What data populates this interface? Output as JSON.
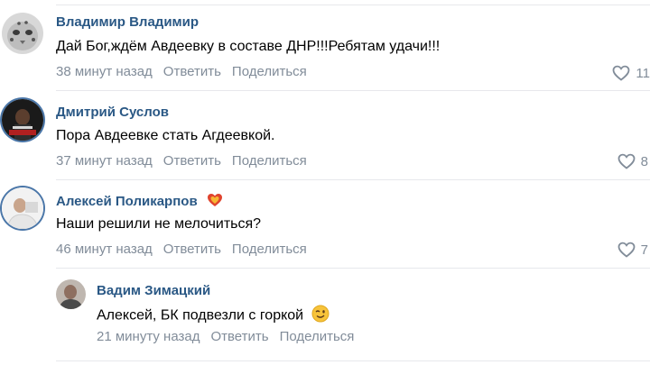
{
  "comments": [
    {
      "author": "Владимир Владимир",
      "text": "Дай Бог,ждём Авдеевку в составе ДНР!!!Ребятам удачи!!!",
      "time": "38 минут назад",
      "reply_label": "Ответить",
      "share_label": "Поделиться",
      "likes": "11",
      "avatar": "snow-leopard-avatar"
    },
    {
      "author": "Дмитрий Суслов",
      "text": "Пора Авдеевке стать Агдеевкой.",
      "time": "37 минут назад",
      "reply_label": "Ответить",
      "share_label": "Поделиться",
      "likes": "8",
      "avatar": "dark-photo-avatar"
    },
    {
      "author": "Алексей Поликарпов",
      "text": "Наши решили не мелочиться?",
      "time": "46 минут назад",
      "reply_label": "Ответить",
      "share_label": "Поделиться",
      "likes": "7",
      "avatar": "person-avatar",
      "badge_icon": "heart-badge-icon"
    }
  ],
  "reply": {
    "author": "Вадим Зимацкий",
    "text": "Алексей, БК подвезли с горкой",
    "time": "21 минуту назад",
    "reply_label": "Ответить",
    "share_label": "Поделиться",
    "avatar": "person-avatar",
    "emoji_icon": "winking-face-icon"
  },
  "colors": {
    "author": "#2a5885",
    "meta": "#818c99",
    "separator": "#e7e8ec"
  }
}
